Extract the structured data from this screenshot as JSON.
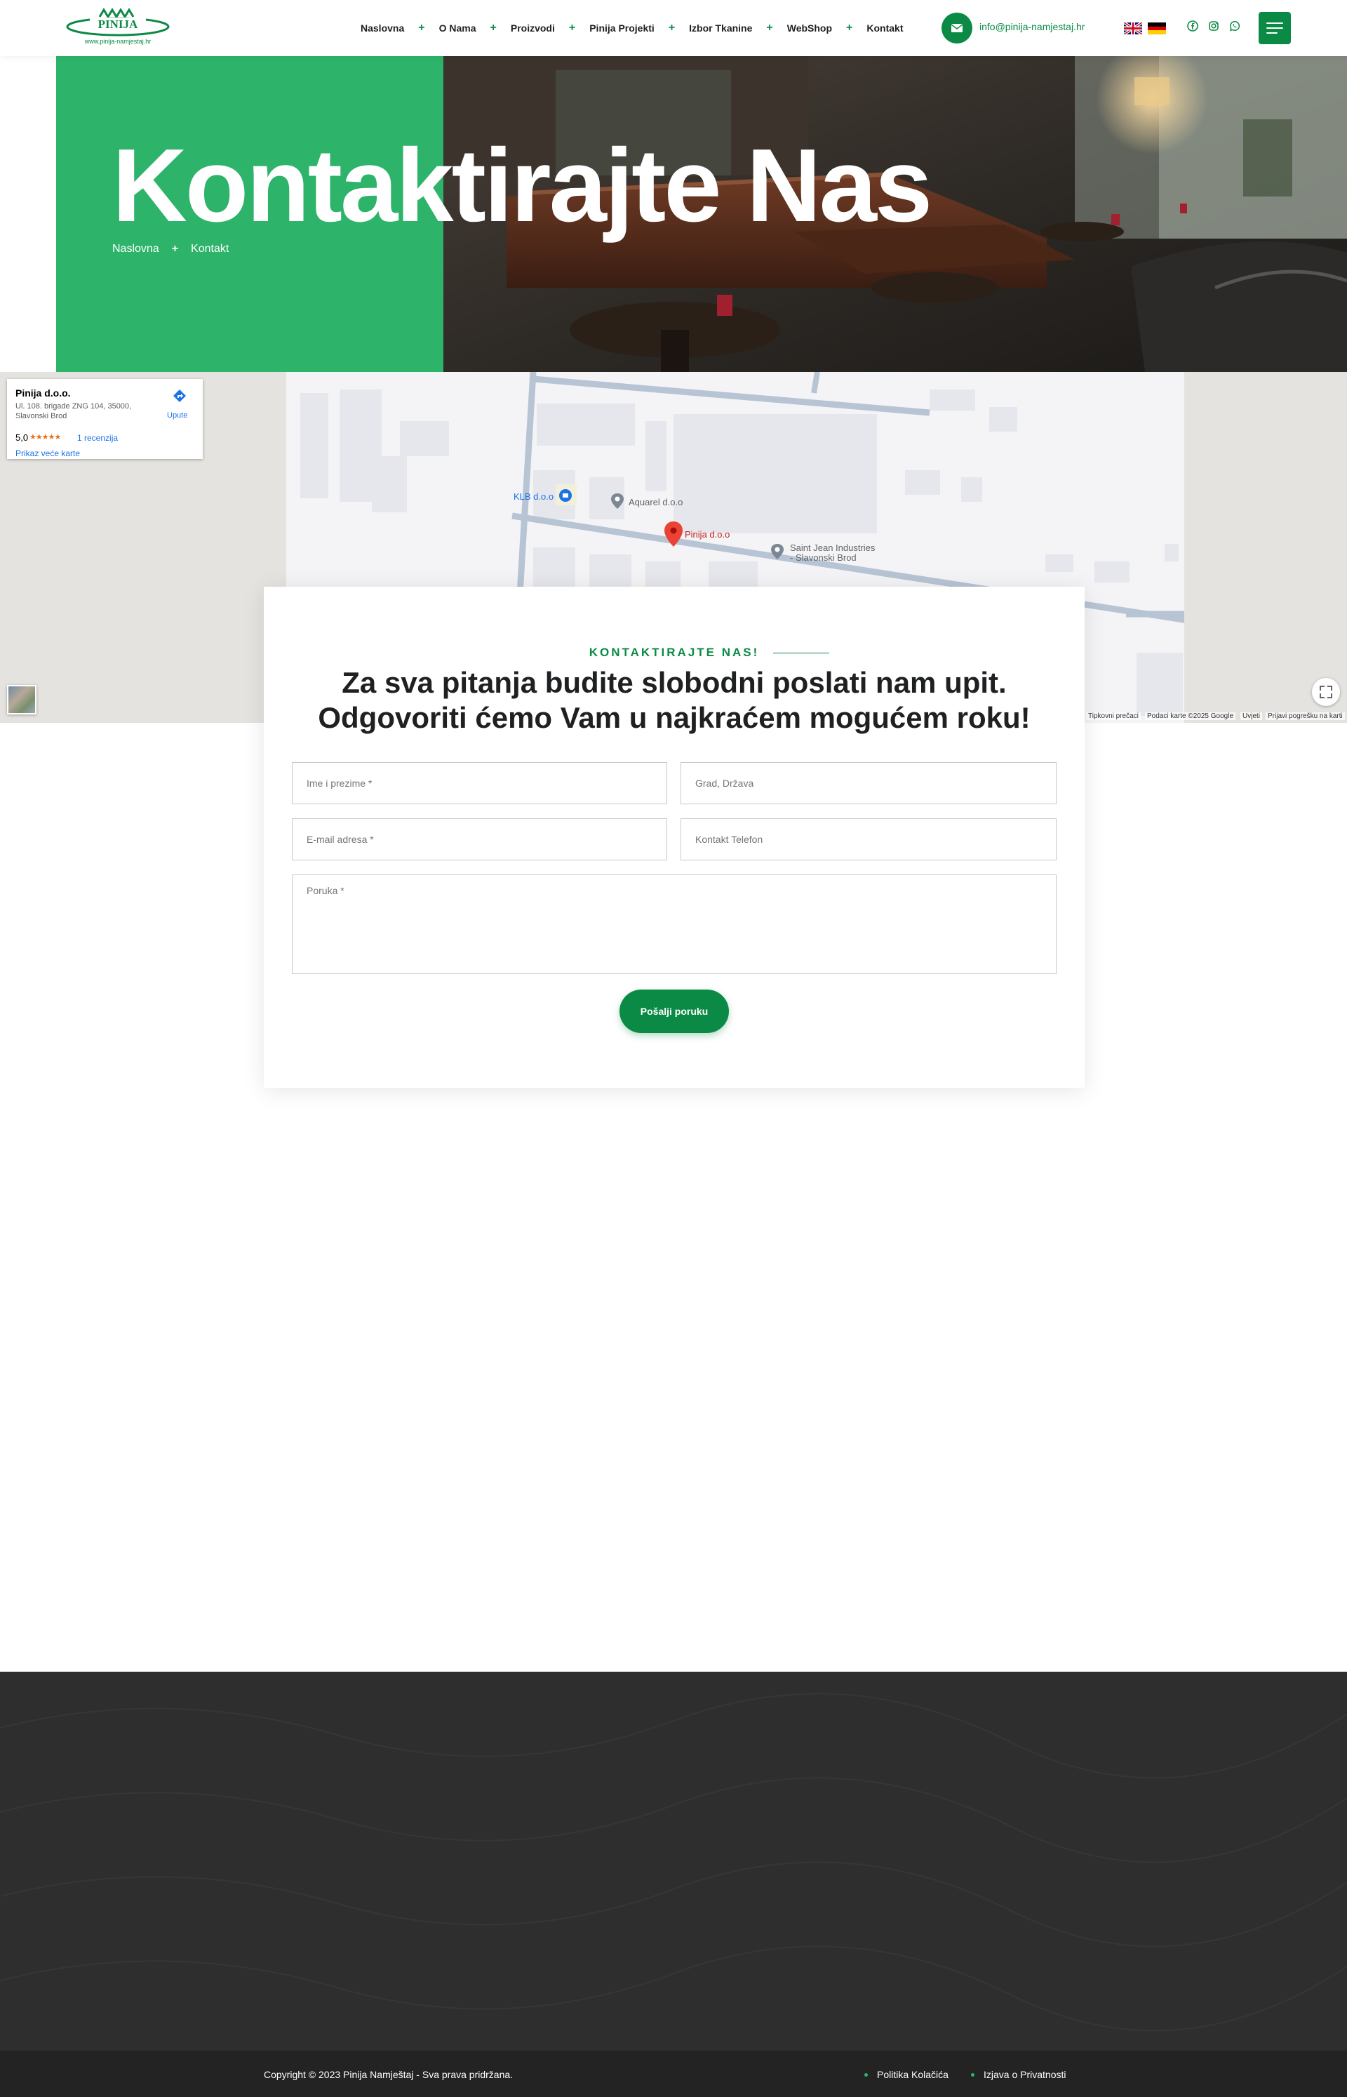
{
  "brand": {
    "logo_text": "PINIJA",
    "logo_url_text": "www.pinija-namjestaj.hr",
    "accent_color": "#0b8a46",
    "hero_green": "#2db46a"
  },
  "nav": {
    "items": [
      "Naslovna",
      "O Nama",
      "Proizvodi",
      "Pinija Projekti",
      "Izbor Tkanine",
      "WebShop",
      "Kontakt"
    ]
  },
  "header": {
    "email": "info@pinija-namjestaj.hr",
    "flags": [
      "uk-flag-icon",
      "german-flag-icon"
    ],
    "social": [
      "facebook-icon",
      "instagram-icon",
      "whatsapp-icon"
    ]
  },
  "hero": {
    "title": "Kontaktirajte Nas",
    "breadcrumb": [
      "Naslovna",
      "Kontakt"
    ],
    "breadcrumb_sep": "+"
  },
  "map": {
    "card": {
      "title": "Pinija d.o.o.",
      "address": "Ul. 108. brigade ZNG 104, 35000, Slavonski Brod",
      "rating": "5,0",
      "stars": "★★★★★",
      "reviews": "1 recenzija",
      "bigger_map": "Prikaz veće karte",
      "directions": "Upute"
    },
    "labels": {
      "klb": "KLB d.o.o",
      "aquarel": "Aquarel d.o.o",
      "pinija": "Pinija d.o.o",
      "saint_jean_1": "Saint Jean Industries",
      "saint_jean_2": "- Slavonski Brod"
    },
    "footer": {
      "shortcuts": "Tipkovni prečaci",
      "data": "Podaci karte ©2025 Google",
      "terms": "Uvjeti",
      "report": "Prijavi pogrešku na karti"
    }
  },
  "form": {
    "eyebrow": "KONTAKTIRAJTE NAS!",
    "heading_line1": "Za sva pitanja budite slobodni poslati nam upit.",
    "heading_line2": "Odgovoriti ćemo Vam u najkraćem mogućem roku!",
    "name_placeholder": "Ime i prezime *",
    "city_placeholder": "Grad, Država",
    "email_placeholder": "E-mail adresa *",
    "phone_placeholder": "Kontakt Telefon",
    "message_placeholder": "Poruka *",
    "submit": "Pošalji poruku"
  },
  "footer": {
    "copyright": "Copyright © 2023 Pinija Namještaj - Sva prava pridržana.",
    "links": [
      "Politika Kolačića",
      "Izjava o Privatnosti"
    ]
  }
}
